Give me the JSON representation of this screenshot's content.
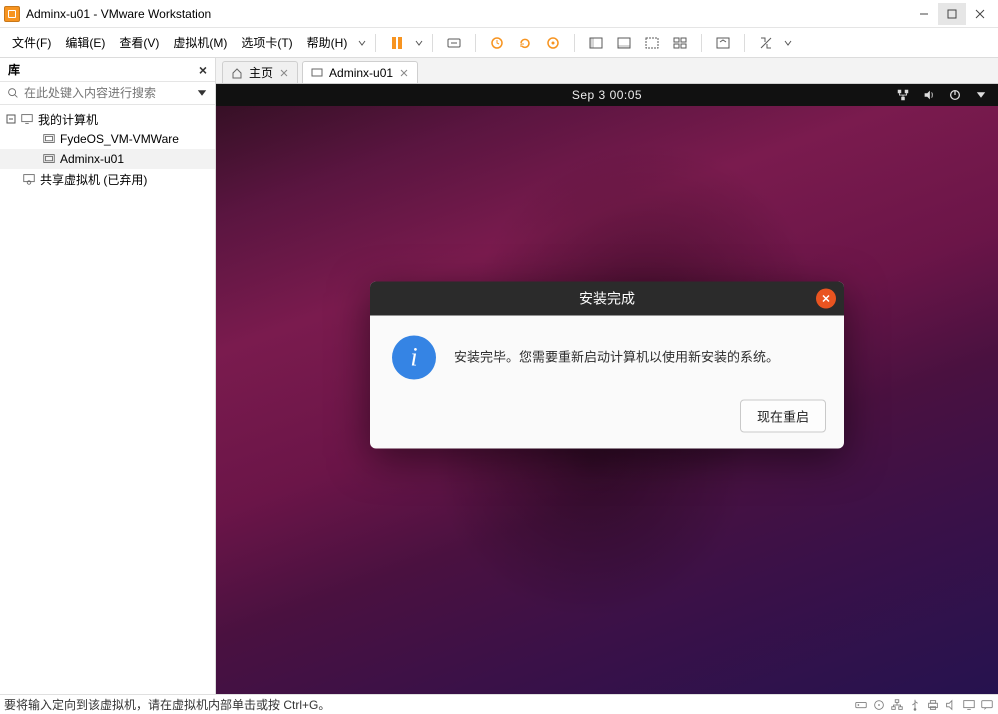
{
  "window": {
    "title": "Adminx-u01 - VMware Workstation"
  },
  "menu": {
    "file": "文件(F)",
    "edit": "编辑(E)",
    "view": "查看(V)",
    "vm": "虚拟机(M)",
    "tabs": "选项卡(T)",
    "help": "帮助(H)"
  },
  "sidebar": {
    "header": "库",
    "search_placeholder": "在此处键入内容进行搜索",
    "nodes": {
      "root": "我的计算机",
      "child1": "FydeOS_VM-VMWare",
      "child2": "Adminx-u01",
      "shared": "共享虚拟机 (已弃用)"
    }
  },
  "tabs": {
    "home": "主页",
    "vm": "Adminx-u01"
  },
  "ubuntu": {
    "datetime": "Sep 3  00:05",
    "dialog": {
      "title": "安装完成",
      "message": "安装完毕。您需要重新启动计算机以使用新安装的系统。",
      "button": "现在重启"
    }
  },
  "statusbar": {
    "hint": "要将输入定向到该虚拟机，请在虚拟机内部单击或按 Ctrl+G。"
  }
}
